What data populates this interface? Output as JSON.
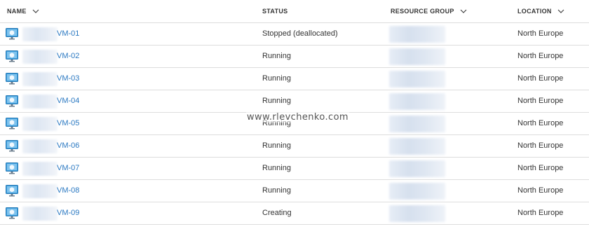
{
  "columns": {
    "name": "NAME",
    "status": "STATUS",
    "resource_group": "RESOURCE GROUP",
    "location": "LOCATION"
  },
  "rows": [
    {
      "name": "VM-01",
      "status": "Stopped (deallocated)",
      "location": "North Europe"
    },
    {
      "name": "VM-02",
      "status": "Running",
      "location": "North Europe"
    },
    {
      "name": "VM-03",
      "status": "Running",
      "location": "North Europe"
    },
    {
      "name": "VM-04",
      "status": "Running",
      "location": "North Europe"
    },
    {
      "name": "VM-05",
      "status": "Running",
      "location": "North Europe"
    },
    {
      "name": "VM-06",
      "status": "Running",
      "location": "North Europe"
    },
    {
      "name": "VM-07",
      "status": "Running",
      "location": "North Europe"
    },
    {
      "name": "VM-08",
      "status": "Running",
      "location": "North Europe"
    },
    {
      "name": "VM-09",
      "status": "Creating",
      "location": "North Europe"
    }
  ],
  "watermark": "www.rlevchenko.com",
  "colors": {
    "link": "#2b79c2",
    "icon_monitor": "#3f9fdc",
    "divider": "#dddddd"
  },
  "icons": {
    "row_icon": "virtual-machine-icon",
    "sort": "chevron-down-icon"
  }
}
